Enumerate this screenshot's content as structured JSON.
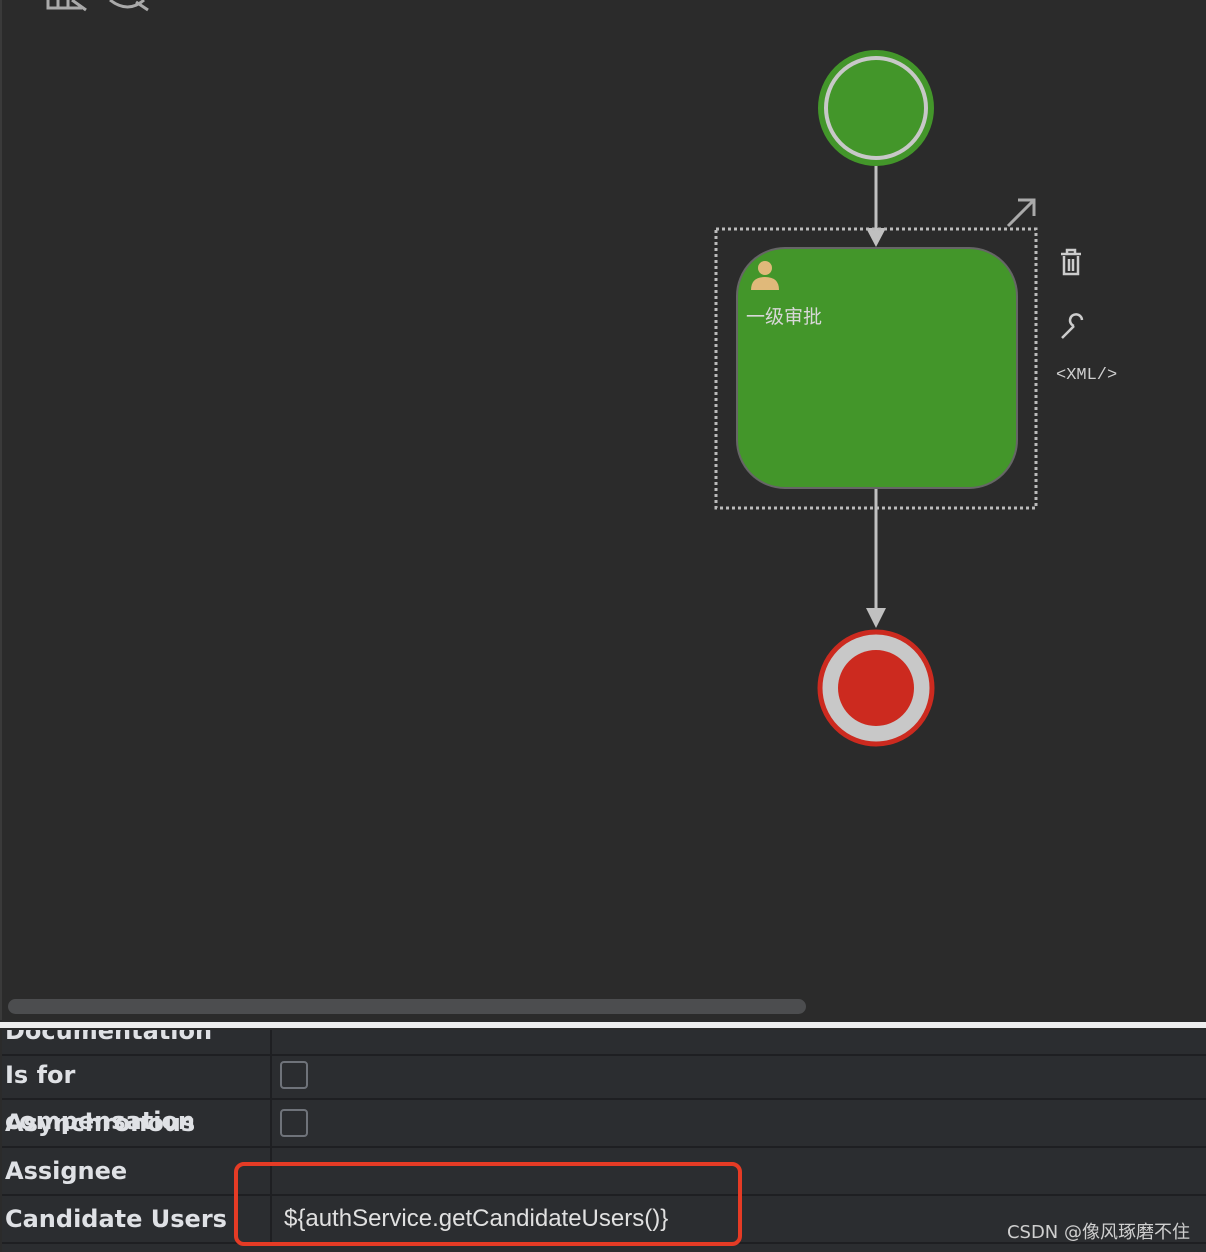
{
  "diagram": {
    "task_label": "一级审批",
    "xml_button": "<XML/>",
    "colors": {
      "start": "#43962a",
      "task": "#43962a",
      "end": "#cc2a1f"
    }
  },
  "properties": {
    "rows": [
      {
        "label": "Documentation",
        "value": ""
      },
      {
        "label": "Is for compensation",
        "checked": false
      },
      {
        "label": "Asynchronous",
        "checked": false
      },
      {
        "label": "Assignee",
        "value": ""
      },
      {
        "label": "Candidate Users",
        "value": "${authService.getCandidateUsers()}"
      }
    ]
  },
  "watermark": "CSDN @像风琢磨不住"
}
